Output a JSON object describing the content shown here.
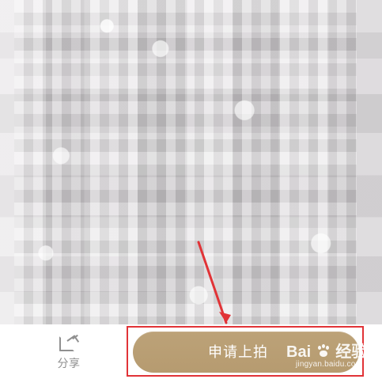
{
  "share": {
    "label": "分享"
  },
  "apply": {
    "label": "申请上拍"
  },
  "watermark": {
    "main_prefix": "Bai",
    "main_suffix": "经验",
    "sub": "jingyan.baidu.com"
  },
  "colors": {
    "page_bg": "#f1eff1",
    "button_gold": "#b69b70",
    "highlight_red": "#e13337",
    "share_gray": "#909090"
  },
  "icons": {
    "share": "share-icon",
    "arrow": "annotation-arrow-icon",
    "paw": "paw-icon"
  }
}
